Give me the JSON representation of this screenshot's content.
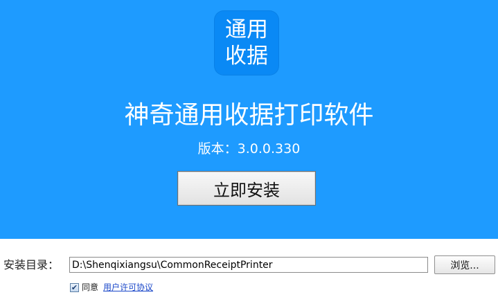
{
  "colors": {
    "hero_background": "#1e9bff",
    "logo_background": "#0a89f5",
    "link": "#1a47c9"
  },
  "hero": {
    "logo_text": "通用收据",
    "title": "神奇通用收据打印软件",
    "version": "版本：3.0.0.330",
    "install_button_label": "立即安装"
  },
  "install": {
    "dir_label": "安装目录：",
    "dir_value": "D:\\Shenqixiangsu\\CommonReceiptPrinter",
    "browse_label": "浏览...",
    "agree_checked": true,
    "agree_label": "同意",
    "license_link": "用户许可协议"
  }
}
